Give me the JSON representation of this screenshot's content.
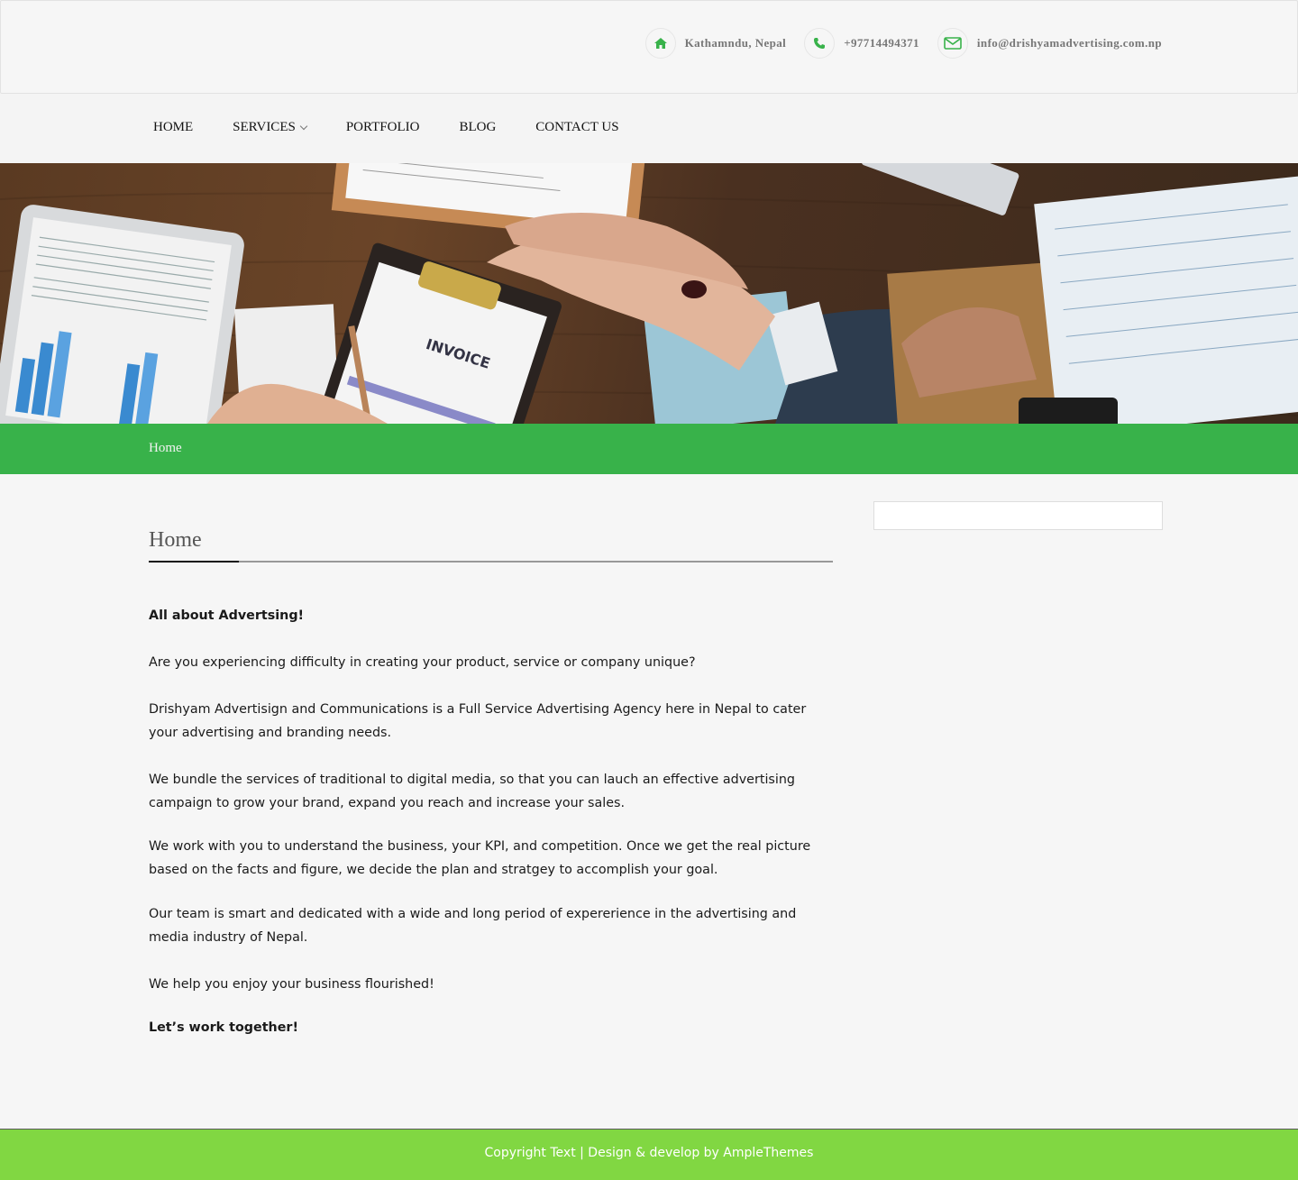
{
  "colors": {
    "accent": "#38b24a",
    "footer": "#81d742",
    "icon": "#38b24a"
  },
  "header": {
    "location": {
      "icon": "home-icon",
      "text": "Kathamndu, Nepal"
    },
    "phone": {
      "icon": "phone-icon",
      "text": "+97714494371"
    },
    "email": {
      "icon": "envelope-icon",
      "text": "info@drishyamadvertising.com.np"
    }
  },
  "nav": {
    "items": [
      {
        "label": "HOME"
      },
      {
        "label": "SERVICES",
        "has_dropdown": true
      },
      {
        "label": "PORTFOLIO"
      },
      {
        "label": "BLOG"
      },
      {
        "label": "CONTACT US"
      }
    ]
  },
  "breadcrumb": {
    "current": "Home"
  },
  "page": {
    "title": "Home",
    "paragraphs": [
      "All about Advertsing!",
      "Are you experiencing difficulty in creating your product, service or company unique?",
      "Drishyam Advertisign and Communications is a Full Service Advertising Agency here in Nepal to cater your advertising and branding needs.",
      "We bundle the services of traditional to digital media, so that you can lauch an effective advertising  campaign to grow your brand, expand you reach and increase your sales.",
      "We work with you to understand the business, your KPI, and competition.  Once we get the real picture based on the facts and figure, we decide the plan and stratgey to accomplish your goal.",
      "Our team is smart and dedicated with a wide and long period of expererience in the advertising and media industry of Nepal.",
      "We help you enjoy your business flourished!",
      "Let’s work together!"
    ]
  },
  "footer": {
    "text": "Copyright Text | Design & develop by AmpleThemes"
  }
}
